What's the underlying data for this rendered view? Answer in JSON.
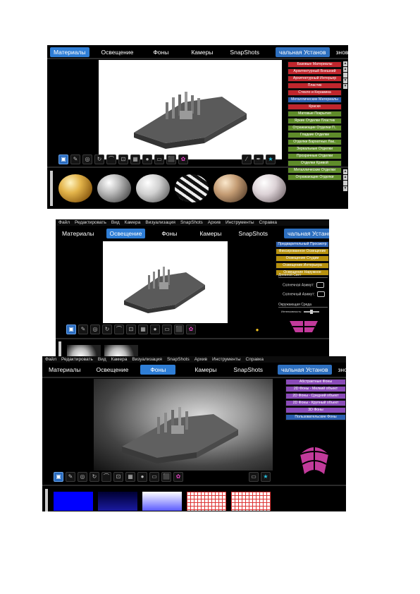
{
  "panel1": {
    "tabs": [
      "Материалы",
      "Освещение",
      "Фоны",
      "Камеры",
      "SnapShots",
      "чальная Установ",
      "зновка Пользова"
    ],
    "active_tab": 0,
    "categories": [
      {
        "label": "Базовые Материалы",
        "color": "red"
      },
      {
        "label": "Архитектурный Внешний",
        "color": "red"
      },
      {
        "label": "Архитектурный Интерьер",
        "color": "red"
      },
      {
        "label": "Пластик",
        "color": "red"
      },
      {
        "label": "Стекло и Керамика",
        "color": "red"
      },
      {
        "label": "Металлические Материалы",
        "color": "blu"
      },
      {
        "label": "Краски",
        "color": "red"
      },
      {
        "label": "Матовые Покрытия",
        "color": "grn"
      },
      {
        "label": "Яркие Отделки Пластик",
        "color": "grn"
      },
      {
        "label": "Отражающие Отделки П..",
        "color": "grn"
      },
      {
        "label": "Гладкие Отделки",
        "color": "grn"
      },
      {
        "label": "Отделки Бархатных Лак..",
        "color": "grn"
      },
      {
        "label": "Зеркальные Отделки",
        "color": "grn"
      },
      {
        "label": "Прозрачные Отделки",
        "color": "grn"
      },
      {
        "label": "Отделки Кривой",
        "color": "grn"
      },
      {
        "label": "Металлические Отделки",
        "color": "grn"
      },
      {
        "label": "Отражающие Отделки",
        "color": "grn"
      }
    ],
    "materials": [
      "gold-sphere",
      "silver-sphere",
      "chrome-sphere",
      "zebra-sphere",
      "bronze-sphere",
      "pearl-sphere"
    ]
  },
  "panel2": {
    "menu": [
      "Файл",
      "Редактировать",
      "Вид",
      "Камера",
      "Визуализация",
      "SnapShots",
      "Архив",
      "Инструменты",
      "Справка"
    ],
    "tabs": [
      "Материалы",
      "Освещение",
      "Фоны",
      "Камеры",
      "SnapShots",
      "чальная Установ"
    ],
    "active_tab": 1,
    "categories": [
      {
        "label": "Предварительный Просмотр",
        "color": "blu"
      },
      {
        "label": "Фиксированное Освещение",
        "color": "ylw"
      },
      {
        "label": "Освещение Студии",
        "color": "ylw"
      },
      {
        "label": "Освещение Интерьера",
        "color": "ylw"
      },
      {
        "label": "Освещение Наружное",
        "color": "ylw"
      }
    ],
    "daylight_label": "Дневной Свет",
    "sun_altitude": "Солнечная Азимут:",
    "sun_lamp": "Солнечный Азимут:",
    "env_label": "Окружающая Среда",
    "intensity_label": "Интенсивность:"
  },
  "panel3": {
    "menu": [
      "Файл",
      "Редактировать",
      "Вид",
      "Камера",
      "Визуализация",
      "SnapShots",
      "Архив",
      "Инструменты",
      "Справка"
    ],
    "tabs": [
      "Материалы",
      "Освещение",
      "Фоны",
      "Камеры",
      "SnapShots",
      "чальная Установ",
      "зновка Пользова"
    ],
    "active_tab": 2,
    "categories": [
      {
        "label": "Абстрактные Фоны",
        "color": "pur"
      },
      {
        "label": "2D Фоны - Мелкий объект",
        "color": "pur"
      },
      {
        "label": "2D Фоны - Средний объект",
        "color": "pur"
      },
      {
        "label": "2D Фоны - Крупный объект",
        "color": "pur"
      },
      {
        "label": "3D Фоны",
        "color": "pur"
      },
      {
        "label": "Пользовательские Фоны",
        "color": "blu"
      }
    ],
    "backgrounds": [
      "blue-solid",
      "blue-gradient",
      "white-blue-gradient",
      "red-grid",
      "red-grid-2"
    ]
  },
  "toolbar_icons": [
    "display-icon",
    "brush-icon",
    "target-icon",
    "arrows-icon",
    "arch-icon",
    "frame-icon",
    "grid-icon",
    "sphere-icon",
    "doc-icon",
    "camera-icon",
    "flower-icon"
  ],
  "colors": {
    "accent": "#2f7ed6",
    "red": "#c0262d",
    "green": "#5f8c2a",
    "yellow": "#b7910e",
    "purple": "#8a4bb8",
    "magenta": "#c23a9b"
  }
}
